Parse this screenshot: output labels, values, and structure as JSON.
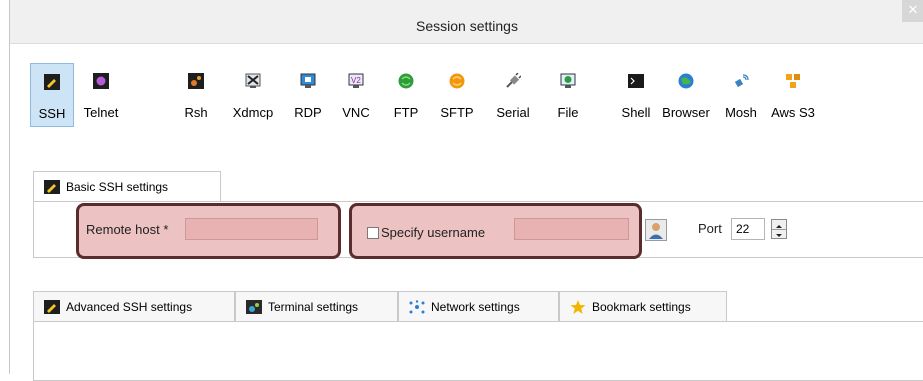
{
  "window": {
    "title": "Session settings",
    "close_glyph": "✕"
  },
  "toolbar": {
    "items": [
      {
        "label": "SSH",
        "icon": "ssh-terminal-icon",
        "selected": true
      },
      {
        "label": "Telnet",
        "icon": "telnet-icon"
      },
      {
        "label": "Rsh",
        "icon": "rsh-icon"
      },
      {
        "label": "Xdmcp",
        "icon": "xdmcp-icon"
      },
      {
        "label": "RDP",
        "icon": "rdp-monitor-icon"
      },
      {
        "label": "VNC",
        "icon": "vnc-monitor-icon"
      },
      {
        "label": "FTP",
        "icon": "ftp-globe-icon"
      },
      {
        "label": "SFTP",
        "icon": "sftp-globe-icon"
      },
      {
        "label": "Serial",
        "icon": "serial-plug-icon"
      },
      {
        "label": "File",
        "icon": "file-monitor-icon"
      },
      {
        "label": "Shell",
        "icon": "shell-terminal-icon"
      },
      {
        "label": "Browser",
        "icon": "browser-globe-icon"
      },
      {
        "label": "Mosh",
        "icon": "mosh-satellite-icon"
      },
      {
        "label": "Aws S3",
        "icon": "aws-s3-cubes-icon"
      }
    ]
  },
  "basic_tab": {
    "label": "Basic SSH settings",
    "icon": "ssh-terminal-icon"
  },
  "basic": {
    "remote_host_label": "Remote host *",
    "remote_host_value": "",
    "specify_username_label": "Specify username",
    "specify_username_checked": false,
    "username_value": "",
    "user_button_icon": "user-icon",
    "port_label": "Port",
    "port_value": "22"
  },
  "bottom_tabs": [
    {
      "label": "Advanced SSH settings",
      "icon": "ssh-terminal-icon"
    },
    {
      "label": "Terminal settings",
      "icon": "terminal-settings-icon"
    },
    {
      "label": "Network settings",
      "icon": "network-icon"
    },
    {
      "label": "Bookmark settings",
      "icon": "star-icon"
    }
  ],
  "colors": {
    "highlight_fill": "#d27070",
    "highlight_border": "#5b2c2c",
    "selected_tool_bg": "#cde4f7"
  }
}
